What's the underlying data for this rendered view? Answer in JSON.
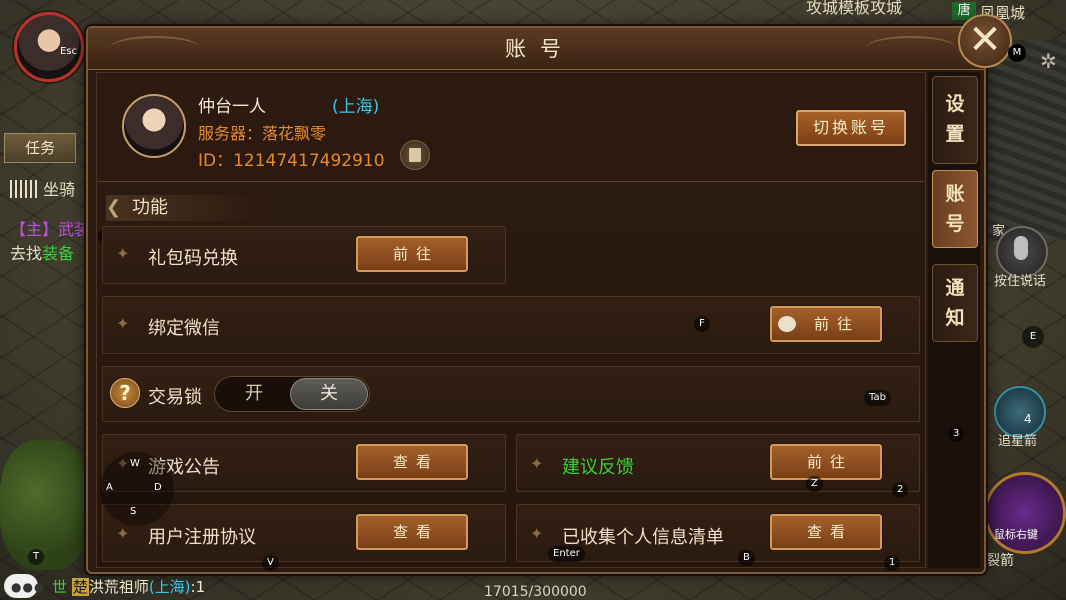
{
  "hud": {
    "esc_label": "Esc",
    "m_key": "M",
    "task_tab": "任务",
    "mount_label": "坐骑",
    "quest_prefix": "【主】",
    "quest_title": "武装",
    "quest_line_prefix": "去找",
    "quest_line_highlight": "装备",
    "city_name": "凤凰城",
    "city_tag": "唐",
    "top_cut_text": "攻城模板攻城",
    "home_label": "家",
    "voice_label": "按住说话",
    "skill_zhui": "追星箭",
    "skill_zhui_key": "4",
    "skill_shubiao": "鼠标右键",
    "skill_lie": "裂箭",
    "exp_text": "17015/300000",
    "keys": {
      "e": "E",
      "three": "3",
      "two": "2",
      "one": "1",
      "z": "Z",
      "b": "B",
      "enter": "Enter",
      "v": "V",
      "t": "T",
      "tab": "Tab",
      "f": "F",
      "w": "W",
      "a": "A",
      "s": "S",
      "d": "D",
      "tilde": "~"
    }
  },
  "chat": {
    "channel": "世",
    "tag": "楚",
    "player": "洪荒祖师",
    "region": "(上海)",
    "text": ":1"
  },
  "dialog": {
    "title": "账号",
    "close_icon": "close-icon",
    "tabs": [
      {
        "label": "设置",
        "active": false
      },
      {
        "label": "账号",
        "active": true
      },
      {
        "label": "通知",
        "active": false
      }
    ],
    "profile": {
      "name": "仲台一人",
      "region": "(上海)",
      "server": "服务器：落花飘零",
      "uid": "ID：12147417492910",
      "switch_button": "切换账号"
    },
    "section_title": "功能",
    "rows": {
      "gift_code": {
        "label": "礼包码兑换",
        "button": "前往"
      },
      "wechat": {
        "label": "绑定微信",
        "button": "前往"
      },
      "trade_lock": {
        "label": "交易锁",
        "on": "开",
        "off": "关",
        "state": "关"
      },
      "announcement": {
        "label": "游戏公告",
        "button": "查看"
      },
      "feedback": {
        "label": "建议反馈",
        "button": "前往"
      },
      "agreement": {
        "label": "用户注册协议",
        "button": "查看"
      },
      "personal_info": {
        "label": "已收集个人信息清单",
        "button": "查看"
      }
    }
  },
  "colors": {
    "accent_orange": "#e58a2a",
    "region_cyan": "#3ac8e8",
    "feedback_green": "#3ad03a",
    "button_brown": "#a4602a"
  }
}
